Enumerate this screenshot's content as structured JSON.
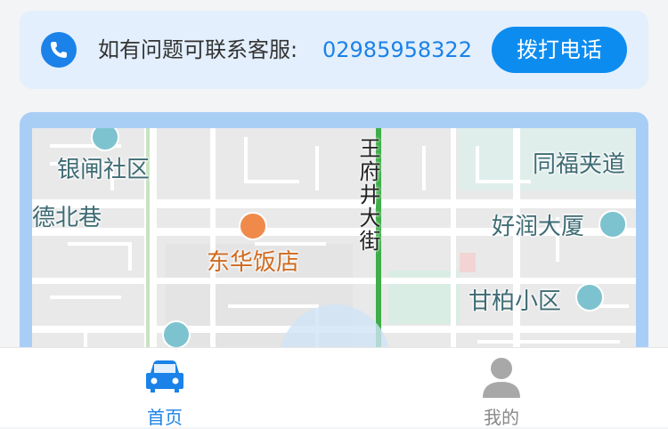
{
  "contact": {
    "label": "如有问题可联系客服:",
    "phone": "02985958322",
    "call_button": "拨打电话"
  },
  "map": {
    "labels": {
      "community_1": "银闸社区",
      "alley": "德北巷",
      "restaurant": "东华饭店",
      "street": "王府井大街",
      "road": "同福夹道",
      "building": "好润大厦",
      "community_2": "甘柏小区"
    }
  },
  "tabs": [
    {
      "label": "首页",
      "icon": "car-icon",
      "active": true
    },
    {
      "label": "我的",
      "icon": "user-icon",
      "active": false
    }
  ],
  "colors": {
    "accent": "#0d8cf0",
    "card_bg": "#e3effc",
    "map_border": "#a9cef6",
    "inactive": "#888888"
  }
}
